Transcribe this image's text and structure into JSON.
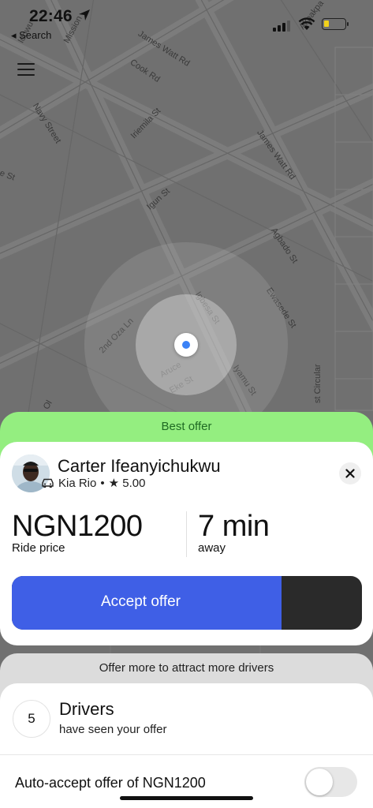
{
  "status_bar": {
    "time": "22:46",
    "back_label": "◂ Search"
  },
  "map": {
    "streets": [
      "Idowu",
      "Mission",
      "James Watt Rd",
      "Cook Rd",
      "Navy Street",
      "Iriemila St",
      "James Watt Rd",
      "e St",
      "Igun St",
      "Agbado St",
      "Ewasede St",
      "2nd Oza Ln",
      "Igbesa St",
      "Aruce",
      "Eke St",
      "Iyamu St",
      "st Circular",
      "Ol",
      "Akpakpa"
    ]
  },
  "offer": {
    "banner_label": "Best offer",
    "driver_name": "Carter Ifeanyichukwu",
    "car_model": "Kia Rio",
    "separator": "•",
    "rating": "★ 5.00",
    "price": "NGN1200",
    "price_label": "Ride price",
    "eta": "7 min",
    "eta_label": "away",
    "accept_label": "Accept offer",
    "accept_countdown_fraction": 0.77
  },
  "attract": {
    "label": "Offer more to attract more drivers"
  },
  "drivers": {
    "count": "5",
    "title": "Drivers",
    "subtitle": "have seen your offer"
  },
  "auto_accept": {
    "label": "Auto-accept offer of NGN1200",
    "enabled": false
  },
  "colors": {
    "accent_blue": "#3f5fe6",
    "best_offer_green": "#94ee80",
    "location_dot": "#3b82f6"
  },
  "icons": {
    "menu": "hamburger-menu-icon",
    "close": "close-icon",
    "car": "car-icon",
    "location": "location-arrow-icon"
  }
}
